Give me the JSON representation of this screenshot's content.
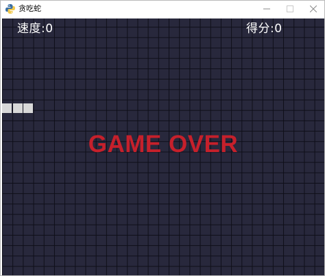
{
  "window": {
    "title": "贪吃蛇",
    "icon": "python-snake-icon",
    "controls": {
      "minimize": "–",
      "maximize": "□",
      "close": "✕"
    }
  },
  "hud": {
    "speed_label": "速度:0",
    "score_label": "得分:0"
  },
  "game": {
    "message": "GAME OVER",
    "message_color": "#c6202b",
    "background_color": "#28283c",
    "snake_color": "#d8d8d8",
    "snake_length": 3
  }
}
